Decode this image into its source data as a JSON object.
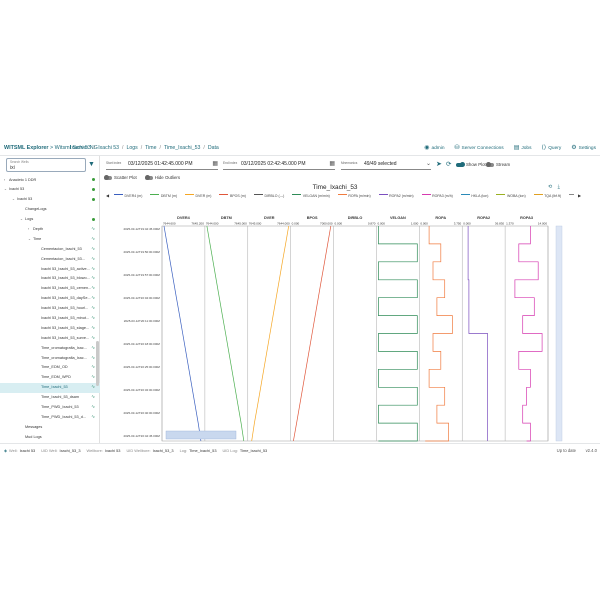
{
  "topbar": {
    "brand": "WITSML Explorer",
    "server_label": "> Witsml Server NG",
    "breadcrumbs": [
      "Ixachi 53",
      "Ixachi 53",
      "Logs",
      "Time",
      "Time_Ixachi_53",
      "Data"
    ],
    "right_items": [
      {
        "icon": "user-icon",
        "label": "admin"
      },
      {
        "icon": "server-connections-icon",
        "label": "Server Connections"
      },
      {
        "icon": "jobs-icon",
        "label": "Jobs"
      },
      {
        "icon": "query-icon",
        "label": "Query"
      },
      {
        "icon": "gear-icon",
        "label": "Settings"
      }
    ]
  },
  "sidebar": {
    "search_label": "Search Wells",
    "search_value": "ixi",
    "items": [
      {
        "label": "Anacleto 1 DDR",
        "level": 0,
        "caret": "›",
        "dot": true
      },
      {
        "label": "Ixachi 53",
        "level": 0,
        "caret": "⌄",
        "dot": true
      },
      {
        "label": "Ixachi 53",
        "level": 1,
        "caret": "⌄",
        "dot": true
      },
      {
        "label": "ChangeLogs",
        "level": 2,
        "caret": ""
      },
      {
        "label": "Logs",
        "level": 2,
        "caret": "⌄",
        "dot": true
      },
      {
        "label": "Depth",
        "level": 3,
        "caret": "›",
        "glyph": true
      },
      {
        "label": "Time",
        "level": 3,
        "caret": "⌄",
        "glyph": true
      },
      {
        "label": "Cementacion_Ixachi_53",
        "level": 4,
        "glyph": true
      },
      {
        "label": "Cementacion_Ixachi_53...",
        "level": 4,
        "glyph": true
      },
      {
        "label": "Ixachi 53_Ixachi_53_active...",
        "level": 4,
        "glyph": true
      },
      {
        "label": "Ixachi 53_Ixachi_53_blowo...",
        "level": 4,
        "glyph": true
      },
      {
        "label": "Ixachi 53_Ixachi_53_cemen...",
        "level": 4,
        "glyph": true
      },
      {
        "label": "Ixachi 53_Ixachi_53_daySe...",
        "level": 4,
        "glyph": true
      },
      {
        "label": "Ixachi 53_Ixachi_53_hourl...",
        "level": 4,
        "glyph": true
      },
      {
        "label": "Ixachi 53_Ixachi_53_minut...",
        "level": 4,
        "glyph": true
      },
      {
        "label": "Ixachi 53_Ixachi_53_stage...",
        "level": 4,
        "glyph": true
      },
      {
        "label": "Ixachi 53_Ixachi_53_surve...",
        "level": 4,
        "glyph": true
      },
      {
        "label": "Time_cromatografia_Ixac...",
        "level": 4,
        "glyph": true
      },
      {
        "label": "Time_cromatografia_Ixac...",
        "level": 4,
        "glyph": true
      },
      {
        "label": "Time_EDM_OD",
        "level": 4,
        "glyph": true
      },
      {
        "label": "Time_EDM_WPD",
        "level": 4,
        "glyph": true
      },
      {
        "label": "Time_Ixachi_53",
        "level": 4,
        "glyph": true,
        "selected": true
      },
      {
        "label": "Time_Ixachi_53_dsam",
        "level": 4,
        "glyph": true
      },
      {
        "label": "Time_PWD_Ixachi_53",
        "level": 4,
        "glyph": true
      },
      {
        "label": "Time_PWD_Ixachi_53_d...",
        "level": 4,
        "glyph": true
      },
      {
        "label": "Messages",
        "level": 2,
        "caret": ""
      },
      {
        "label": "Mud Logs",
        "level": 2,
        "caret": ""
      }
    ]
  },
  "range": {
    "start_label": "Start index",
    "start_value": "03/12/2025 01:42:45.000  PM",
    "end_label": "End index",
    "end_value": "03/12/2025 02:42:45.000  PM",
    "mnemonics_label": "Mnemonics",
    "mnemonics_value": "49/49 selected",
    "show_plot_label": "Show Plot",
    "stream_label": "Stream"
  },
  "options": {
    "scatter_label": "Scatter Plot",
    "outliers_label": "Hide Outliers"
  },
  "chart_data": {
    "type": "line",
    "title": "Time_Ixachi_53",
    "orientation": "vertical-index",
    "legend": [
      "DVER4 (m)",
      "DBTM (m)",
      "DVER (m)",
      "BPOS (m)",
      "DIRBLO (---)",
      "VELGAN (m/min)",
      "ROPA (m/min)",
      "ROPA2 (m/min)",
      "ROPA3 (m/h)",
      "HKLA (ton)",
      "WOBA (ton)",
      "TQA (lbf.ft)",
      "SP"
    ],
    "tracks": [
      {
        "name": "DVER4",
        "min": "7644.600",
        "max": "7645.200",
        "color": "#3a5fbf",
        "x": [
          0.0,
          0.08,
          0.16,
          0.24,
          0.32,
          0.4,
          0.48,
          0.56,
          0.64,
          0.72,
          0.8,
          0.88,
          0.95
        ]
      },
      {
        "name": "DBTM",
        "min": "7644.000",
        "max": "7645.000",
        "color": "#4caf50",
        "x": [
          0.0,
          0.08,
          0.16,
          0.24,
          0.32,
          0.4,
          0.48,
          0.56,
          0.64,
          0.72,
          0.8,
          0.88,
          0.95
        ]
      },
      {
        "name": "DVER",
        "min": "7645.000",
        "max": "7644.000",
        "color": "#f5a623",
        "x": [
          1.0,
          0.92,
          0.84,
          0.76,
          0.68,
          0.6,
          0.52,
          0.44,
          0.36,
          0.28,
          0.2,
          0.12,
          0.05
        ]
      },
      {
        "name": "BPOS",
        "min": "0.000",
        "max": "7000.000",
        "color": "#e0563a",
        "x": [
          0.98,
          0.9,
          0.82,
          0.74,
          0.66,
          0.58,
          0.5,
          0.42,
          0.34,
          0.26,
          0.18,
          0.1,
          0.02
        ]
      },
      {
        "name": "DIRBLO",
        "min": "0.000",
        "max": "0.870",
        "color": "#555555",
        "x": []
      },
      {
        "name": "VELGAN",
        "min": "0.000",
        "max": "1.000",
        "color": "#2e8b57",
        "x": [
          0.0,
          1.0,
          0.0,
          1.0,
          0.0,
          1.0,
          0.0,
          1.0,
          0.0,
          1.0,
          0.0,
          1.0,
          0.0
        ]
      },
      {
        "name": "ROPA",
        "min": "0.000",
        "max": "3.750",
        "color": "#f07b3f",
        "x": [
          0.2,
          0.5,
          0.3,
          0.6,
          0.4,
          0.8,
          0.3,
          0.5,
          0.2,
          0.6,
          0.4,
          0.7,
          0.1
        ]
      },
      {
        "name": "ROPA2",
        "min": "0.000",
        "max": "36.830",
        "color": "#7b4fbf",
        "x": [
          0.1,
          0.1,
          0.1,
          0.12,
          0.12,
          0.12,
          0.6,
          0.6,
          0.6,
          0.6,
          0.6,
          0.6,
          0.6
        ]
      },
      {
        "name": "ROPA3",
        "min": "1.370",
        "max": "14.000",
        "color": "#d63ab0",
        "x": [
          0.6,
          0.3,
          0.8,
          0.2,
          0.7,
          0.4,
          0.9,
          0.3,
          0.6,
          0.5,
          0.4,
          0.6,
          0.5
        ]
      }
    ],
    "top_ticks": [
      "1.370",
      "14.000",
      "14.960"
    ],
    "y_ticks": [
      "2025-03-12T19:42:45.000Z",
      "2025-03-12T19:50:00.000Z",
      "2025-03-12T19:57:00.000Z",
      "2025-03-12T20:04:00.000Z",
      "2025-03-12T20:11:00.000Z",
      "2025-03-12T20:18:00.000Z",
      "2025-03-12T20:25:00.000Z",
      "2025-03-12T20:32:00.000Z",
      "2025-03-12T20:40:00.000Z",
      "2025-03-12T20:42:45.000Z"
    ]
  },
  "status": {
    "items": [
      {
        "icon": "well-icon",
        "key": "Well:",
        "value": "Ixachi 53"
      },
      {
        "icon": "",
        "key": "UID Well:",
        "value": "Ixachi_53_3"
      },
      {
        "icon": "",
        "key": "Wellbore:",
        "value": "Ixachi 53"
      },
      {
        "icon": "",
        "key": "UID Wellbore:",
        "value": "Ixachi_53_3"
      },
      {
        "icon": "",
        "key": "Log:",
        "value": "Time_Ixachi_53"
      },
      {
        "icon": "",
        "key": "UID Log:",
        "value": "Time_Ixachi_53"
      }
    ],
    "uptodate": "Up to date",
    "version": "v2.4.0"
  },
  "colors": {
    "accent": "#1f6b7a",
    "selected_bg": "#d8eef2"
  }
}
